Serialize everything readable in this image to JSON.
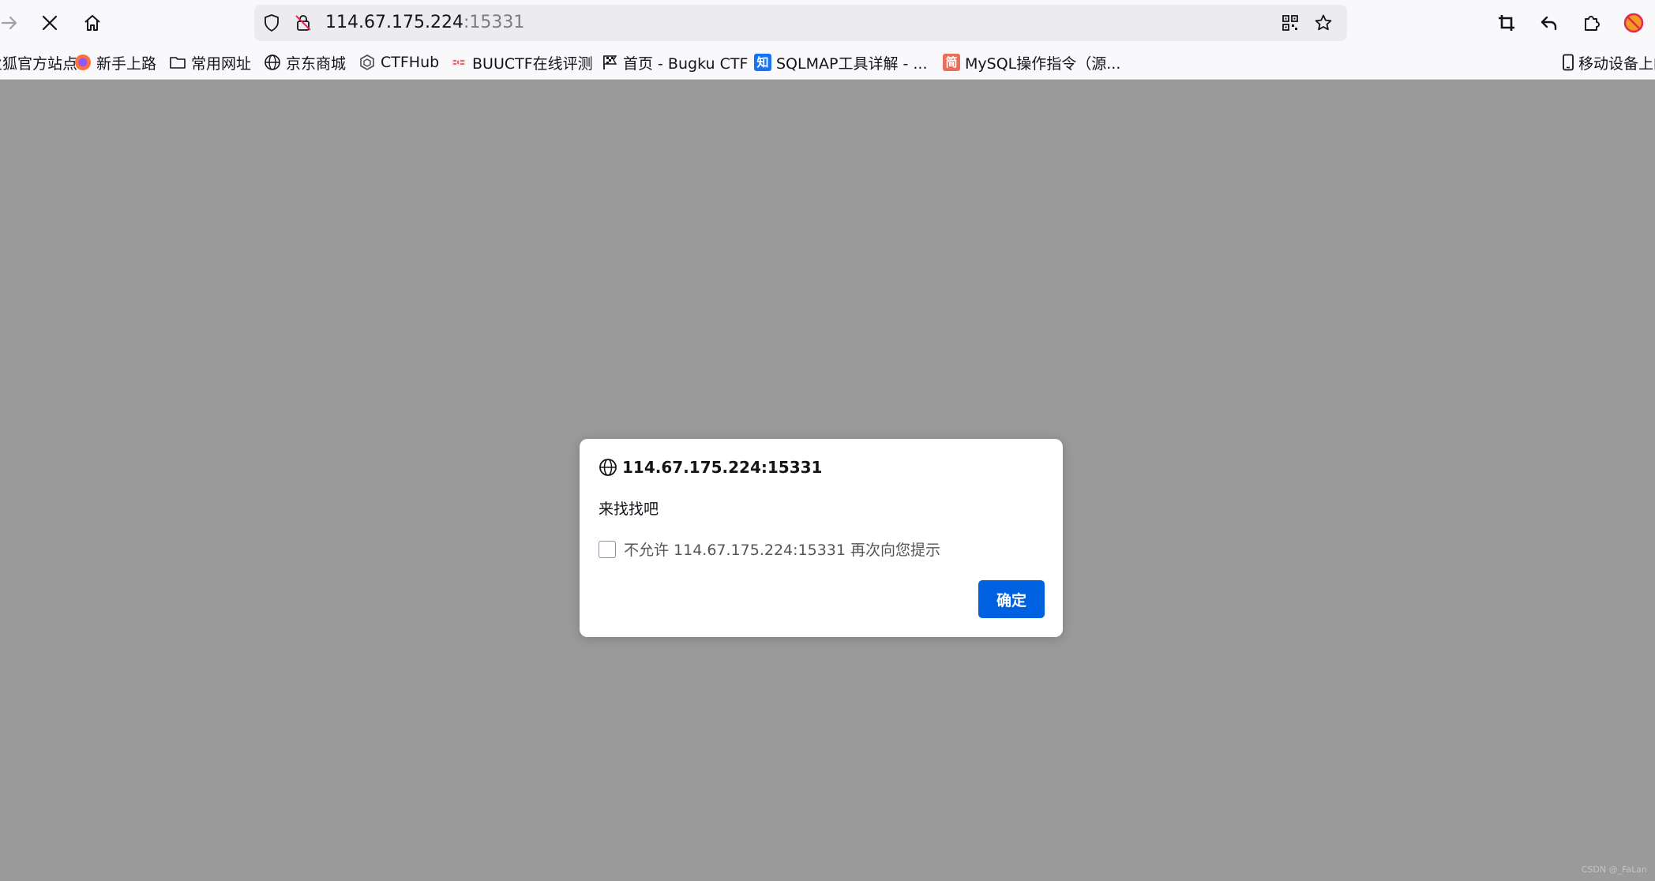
{
  "browser": {
    "url_host": "114.67.175.224",
    "url_port": ":15331",
    "icons": {
      "forward": "forward-arrow-icon",
      "stop": "close-icon",
      "home": "home-icon",
      "shield": "shield-icon",
      "insecure": "insecure-lock-icon",
      "qr": "qr-code-icon",
      "star": "bookmark-star-icon",
      "screenshot": "crop-icon",
      "undo": "undo-icon",
      "extensions": "puzzle-icon",
      "profile": "blocked-icon"
    }
  },
  "bookmarks": [
    {
      "label": "火狐官方站点",
      "icon": "firefox-icon"
    },
    {
      "label": "新手上路",
      "icon": "firefox-icon"
    },
    {
      "label": "常用网址",
      "icon": "folder-icon"
    },
    {
      "label": "京东商城",
      "icon": "globe-icon"
    },
    {
      "label": "CTFHub",
      "icon": "ctfhub-icon"
    },
    {
      "label": "BUUCTF在线评测",
      "icon": "buuctf-icon"
    },
    {
      "label": "首页 - Bugku CTF",
      "icon": "flag-icon"
    },
    {
      "label": "SQLMAP工具详解 - ...",
      "icon": "zhihu-icon"
    },
    {
      "label": "MySQL操作指令（源...",
      "icon": "jianshu-icon"
    },
    {
      "label": "移动设备上的",
      "icon": "mobile-icon"
    }
  ],
  "favicon_text": {
    "zhihu": "知",
    "jianshu": "简"
  },
  "dialog": {
    "origin": "114.67.175.224:15331",
    "message": "来找找吧",
    "checkbox_label": "不允许 114.67.175.224:15331 再次向您提示",
    "checkbox_checked": false,
    "ok_label": "确定"
  },
  "watermark": "CSDN @_FaLan",
  "colors": {
    "accent": "#0061e0",
    "overlay": "#9a9a9b",
    "toolbar": "#f9f9fb"
  }
}
